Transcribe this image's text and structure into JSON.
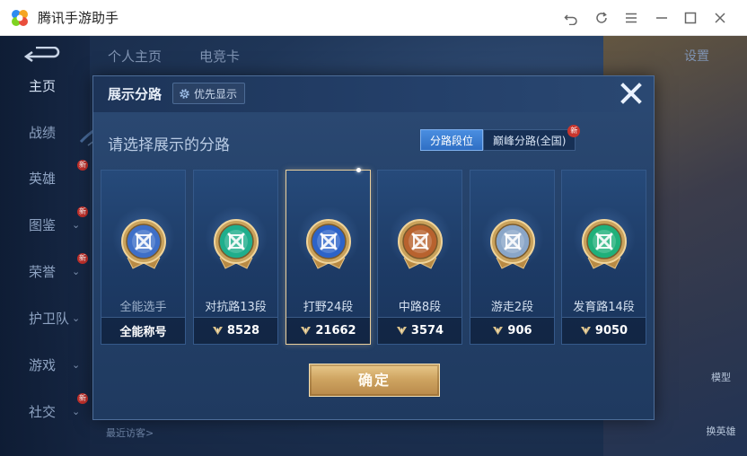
{
  "window": {
    "title": "腾讯手游助手"
  },
  "background": {
    "tabs": [
      "个人主页",
      "电竞卡"
    ],
    "settings_label": "设置",
    "nav_items": [
      {
        "label": "主页",
        "active": true,
        "has_chevron": false,
        "is_new": false
      },
      {
        "label": "战绩",
        "active": false,
        "has_chevron": false,
        "is_new": false
      },
      {
        "label": "英雄",
        "active": false,
        "has_chevron": false,
        "is_new": true
      },
      {
        "label": "图鉴",
        "active": false,
        "has_chevron": true,
        "is_new": true
      },
      {
        "label": "荣誉",
        "active": false,
        "has_chevron": true,
        "is_new": true
      },
      {
        "label": "护卫队",
        "active": false,
        "has_chevron": true,
        "is_new": false
      },
      {
        "label": "游戏",
        "active": false,
        "has_chevron": true,
        "is_new": false
      },
      {
        "label": "社交",
        "active": false,
        "has_chevron": true,
        "is_new": true
      }
    ],
    "new_mark": "新",
    "recent_visitors": "最近访客>",
    "side_buttons": [
      "模型",
      "换英雄"
    ]
  },
  "modal": {
    "title": "展示分路",
    "priority_label": "优先显示",
    "subtitle": "请选择展示的分路",
    "toggle": {
      "options": [
        "分路段位",
        "巅峰分路(全国)"
      ],
      "selected": 0,
      "new_mark": "新"
    },
    "cards": [
      {
        "label": "全能选手",
        "score": "全能称号",
        "show_icon": false,
        "selected": false,
        "badge_color": "#3e6fc8",
        "emblem": "allround-emblem"
      },
      {
        "label": "对抗路13段",
        "score": "8528",
        "show_icon": true,
        "selected": false,
        "badge_color": "#1fae8c",
        "emblem": "clash-lane-emblem"
      },
      {
        "label": "打野24段",
        "score": "21662",
        "show_icon": true,
        "selected": true,
        "badge_color": "#2d63c8",
        "emblem": "jungle-emblem"
      },
      {
        "label": "中路8段",
        "score": "3574",
        "show_icon": true,
        "selected": false,
        "badge_color": "#b8622e",
        "emblem": "mid-lane-emblem"
      },
      {
        "label": "游走2段",
        "score": "906",
        "show_icon": true,
        "selected": false,
        "badge_color": "#8aa6c8",
        "emblem": "roam-emblem"
      },
      {
        "label": "发育路14段",
        "score": "9050",
        "show_icon": true,
        "selected": false,
        "badge_color": "#1fb07a",
        "emblem": "farm-lane-emblem"
      }
    ],
    "confirm_label": "确定"
  },
  "colors": {
    "accent_gold": "#e9c98c",
    "toggle_active": "#3f82d8",
    "modal_bg": "#25426a"
  }
}
